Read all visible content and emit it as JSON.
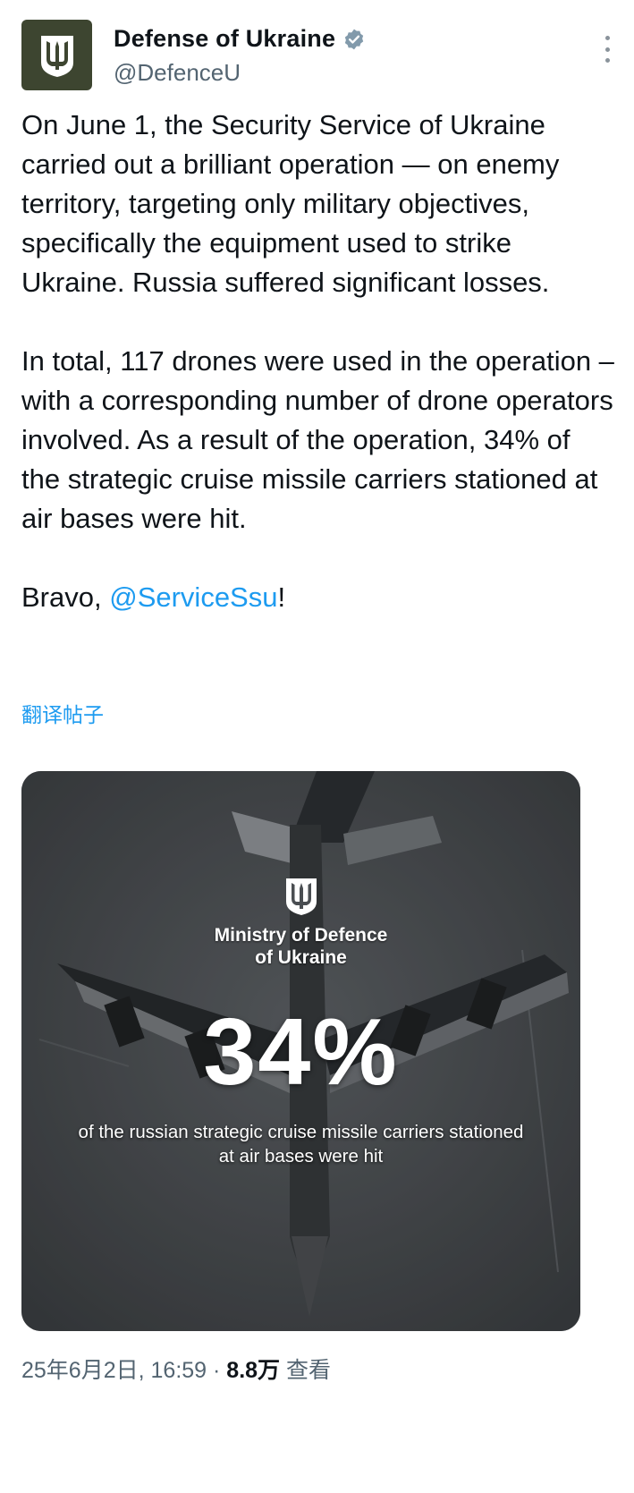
{
  "post": {
    "author": {
      "display_name": "Defense of Ukraine",
      "handle": "@DefenceU",
      "verified": true,
      "avatar_icon": "trident-emblem-icon"
    },
    "more_icon": "more-options-icon",
    "paragraph1": "On June 1, the Security Service of Ukraine carried out a brilliant operation — on enemy territory, targeting only military objectives, specifically the equipment used to strike Ukraine. Russia suffered significant losses.",
    "paragraph2": "In total, 117 drones were used in the operation – with a corresponding number of drone operators involved. As a result of the operation, 34% of the strategic cruise missile carriers stationed at air bases were hit.",
    "paragraph3_prefix": "Bravo, ",
    "mention": "@ServiceSsu",
    "paragraph3_suffix": "!",
    "translate_label": "翻译帖子"
  },
  "media": {
    "emblem_icon": "trident-emblem-icon",
    "ministry_line1": "Ministry of Defence",
    "ministry_line2": "of Ukraine",
    "big_stat": "34%",
    "caption": "of the russian strategic cruise missile carriers stationed at air bases were hit"
  },
  "meta": {
    "timestamp": "25年6月2日, 16:59",
    "separator": " · ",
    "views_count": "8.8万",
    "views_label": " 查看"
  },
  "colors": {
    "link": "#1d9bf0",
    "text": "#0f1419",
    "secondary": "#536471",
    "avatar_bg": "#3d4530"
  }
}
